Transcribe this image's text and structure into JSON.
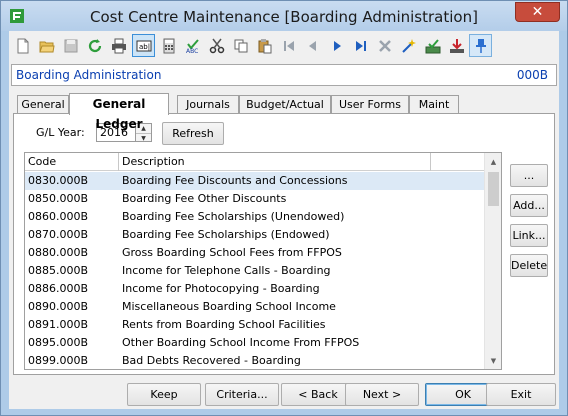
{
  "window": {
    "title": "Cost Centre Maintenance  [Boarding Administration]",
    "close_label": "✕"
  },
  "toolbar": {
    "buttons": [
      {
        "name": "new-icon"
      },
      {
        "name": "open-folder-icon"
      },
      {
        "name": "save-icon"
      },
      {
        "name": "refresh-icon"
      },
      {
        "name": "print-icon"
      },
      {
        "name": "text-field-icon"
      },
      {
        "name": "calculator-icon"
      },
      {
        "name": "spellcheck-icon"
      },
      {
        "name": "cut-icon"
      },
      {
        "name": "copy-icon"
      },
      {
        "name": "paste-icon"
      },
      {
        "name": "first-record-icon"
      },
      {
        "name": "previous-record-icon"
      },
      {
        "name": "next-record-icon"
      },
      {
        "name": "last-record-icon"
      },
      {
        "name": "delete-icon"
      },
      {
        "name": "wizard-icon"
      },
      {
        "name": "approve-icon"
      },
      {
        "name": "download-icon"
      },
      {
        "name": "pin-icon"
      }
    ]
  },
  "header": {
    "title": "Boarding Administration",
    "code": "000B"
  },
  "tabs": [
    {
      "label": "General",
      "active": false
    },
    {
      "label": "General Ledger",
      "active": true
    },
    {
      "label": "Journals",
      "active": false
    },
    {
      "label": "Budget/Actual",
      "active": false
    },
    {
      "label": "User Forms",
      "active": false
    },
    {
      "label": "Maint",
      "active": false
    }
  ],
  "gl": {
    "year_label": "G/L Year:",
    "year_value": "2016",
    "refresh_label": "Refresh"
  },
  "grid": {
    "columns": [
      "Code",
      "Description"
    ],
    "rows": [
      {
        "code": "0830.000B",
        "description": "Boarding Fee Discounts and Concessions"
      },
      {
        "code": "0850.000B",
        "description": "Boarding Fee Other Discounts"
      },
      {
        "code": "0860.000B",
        "description": "Boarding Fee Scholarships (Unendowed)"
      },
      {
        "code": "0870.000B",
        "description": "Boarding Fee Scholarships (Endowed)"
      },
      {
        "code": "0880.000B",
        "description": "Gross Boarding School Fees from FFPOS"
      },
      {
        "code": "0885.000B",
        "description": "Income for Telephone Calls - Boarding"
      },
      {
        "code": "0886.000B",
        "description": "Income for Photocopying - Boarding"
      },
      {
        "code": "0890.000B",
        "description": "Miscellaneous Boarding School Income"
      },
      {
        "code": "0891.000B",
        "description": "Rents from Boarding School Facilities"
      },
      {
        "code": "0895.000B",
        "description": "Other Boarding School Income From FFPOS"
      },
      {
        "code": "0899.000B",
        "description": "Bad Debts Recovered - Boarding"
      }
    ],
    "selected_index": 0
  },
  "side_buttons": {
    "more": "...",
    "add": "Add...",
    "link": "Link...",
    "delete": "Delete"
  },
  "footer": {
    "keep": "Keep",
    "criteria": "Criteria...",
    "back": "< Back",
    "next": "Next >",
    "ok": "OK",
    "exit": "Exit"
  }
}
